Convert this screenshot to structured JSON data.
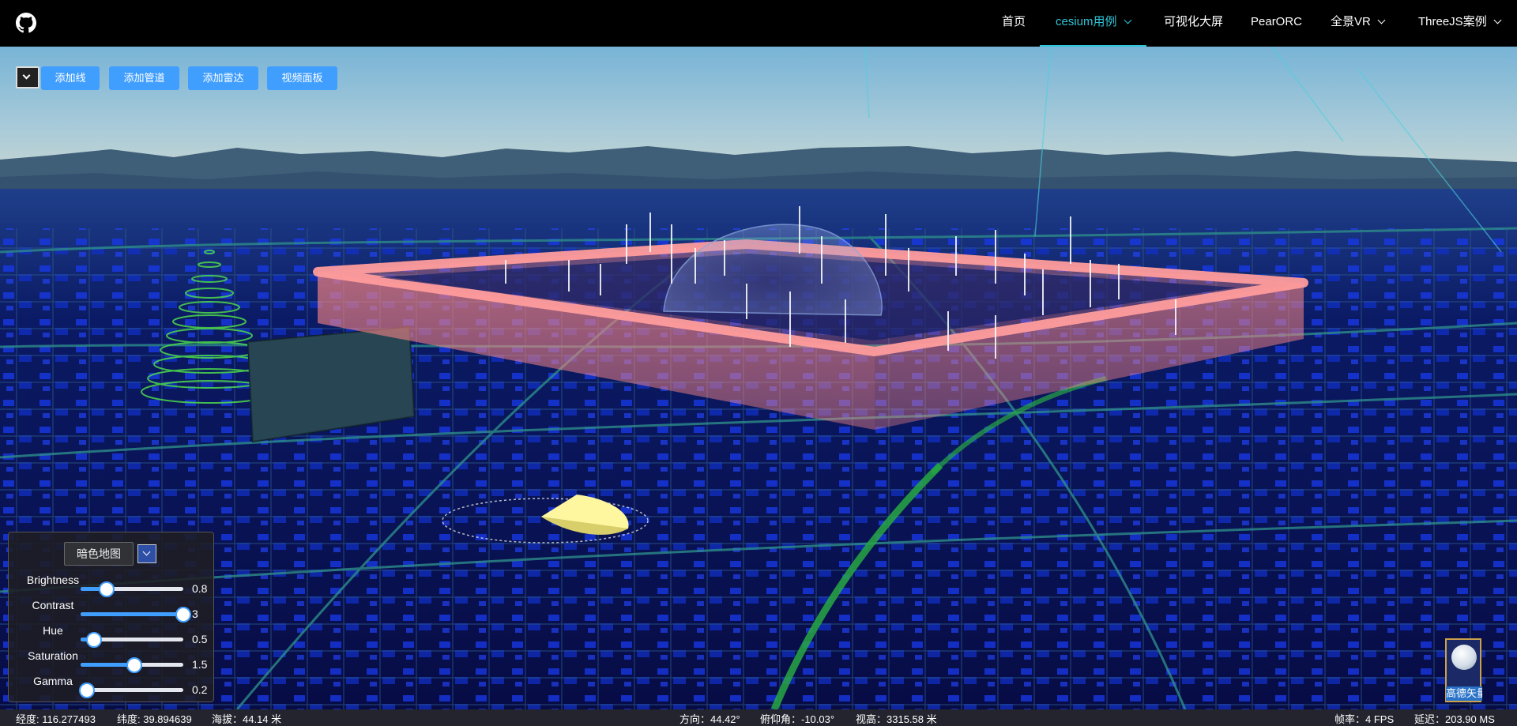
{
  "navbar": {
    "items": [
      {
        "label": "首页"
      },
      {
        "label": "cesium用例"
      },
      {
        "label": "可视化大屏"
      },
      {
        "label": "PearORC"
      },
      {
        "label": "全景VR"
      },
      {
        "label": "ThreeJS案例"
      }
    ],
    "active_item": "cesium用例",
    "icons": {
      "logo": "github-icon",
      "dropdown": "chevron-down-icon"
    },
    "accent_color": "#2ec5d8"
  },
  "toolbar": {
    "buttons": [
      {
        "label": "添加线"
      },
      {
        "label": "添加管道"
      },
      {
        "label": "添加雷达"
      },
      {
        "label": "视频面板"
      }
    ],
    "button_color": "#409eff"
  },
  "layer_panel": {
    "map_select": "暗色地图",
    "sliders": [
      {
        "label": "Brightness",
        "value": "0.8",
        "fraction": 0.25
      },
      {
        "label": "Contrast",
        "value": "3",
        "fraction": 1.0
      },
      {
        "label": "Hue",
        "value": "0.5",
        "fraction": 0.13
      },
      {
        "label": "Saturation",
        "value": "1.5",
        "fraction": 0.52
      },
      {
        "label": "Gamma",
        "value": "0.2",
        "fraction": 0.06
      }
    ]
  },
  "basemap": {
    "label": "高德矢量"
  },
  "statusbar": {
    "longitude": "经度: 116.277493",
    "latitude": "纬度: 39.894639",
    "altitude": "海拔：44.14 米",
    "heading": "方向：44.42°",
    "pitch": "俯仰角：-10.03°",
    "view_height": "视高：3315.58 米",
    "fps": "帧率：4 FPS",
    "latency": "延迟：203.90 MS"
  }
}
